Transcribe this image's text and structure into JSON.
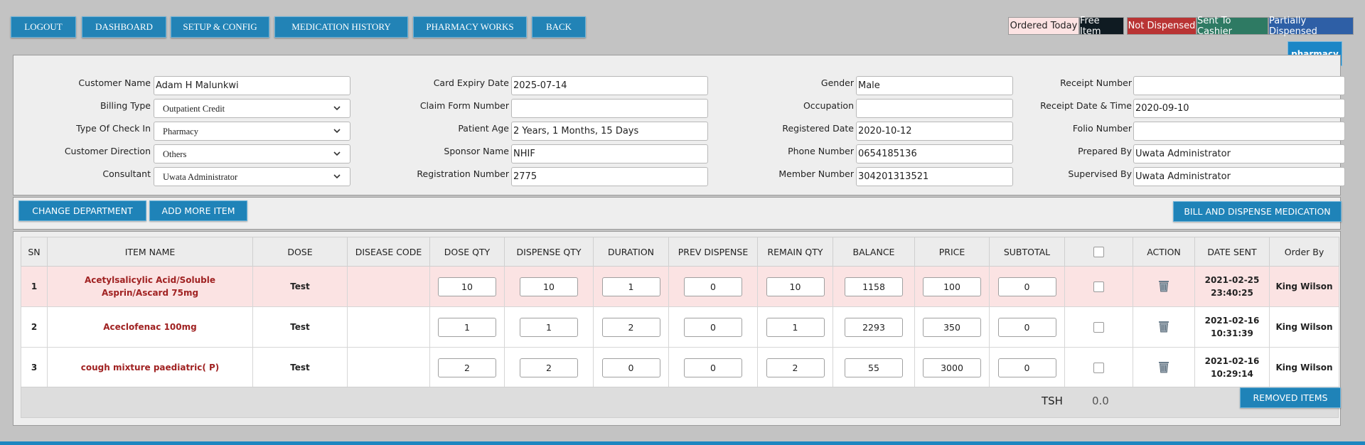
{
  "nav": {
    "logout": "LOGOUT",
    "dashboard": "DASHBOARD",
    "setup": "SETUP & CONFIG",
    "medication_history": "MEDICATION HISTORY",
    "pharmacy_works": "PHARMACY WORKS",
    "back": "BACK"
  },
  "legend": {
    "ordered_today": "Ordered Today",
    "free_item": "Free Item",
    "not_dispensed": "Not Dispensed",
    "sent_to_cashier": "Sent To Cashier",
    "partially_dispensed": "Partially Dispensed",
    "colors": {
      "ordered_today": "#fde3e3",
      "free_item": "#0f1b22",
      "not_dispensed": "#b93434",
      "sent_to_cashier": "#2e7a63",
      "partially_dispensed": "#2e5fa6"
    }
  },
  "department_tab": "pharmacy",
  "form": {
    "customer_name": {
      "label": "Customer Name",
      "value": "Adam H Malunkwi"
    },
    "billing_type": {
      "label": "Billing Type",
      "value": "Outpatient Credit"
    },
    "type_of_check_in": {
      "label": "Type Of Check In",
      "value": "Pharmacy"
    },
    "customer_direction": {
      "label": "Customer Direction",
      "value": "Others"
    },
    "consultant": {
      "label": "Consultant",
      "value": "Uwata Administrator"
    },
    "card_expiry_date": {
      "label": "Card Expiry Date",
      "value": "2025-07-14"
    },
    "claim_form_number": {
      "label": "Claim Form Number",
      "value": ""
    },
    "patient_age": {
      "label": "Patient Age",
      "value": "2 Years, 1 Months, 15 Days"
    },
    "sponsor_name": {
      "label": "Sponsor Name",
      "value": "NHIF"
    },
    "registration_number": {
      "label": "Registration Number",
      "value": "2775"
    },
    "gender": {
      "label": "Gender",
      "value": "Male"
    },
    "occupation": {
      "label": "Occupation",
      "value": ""
    },
    "registered_date": {
      "label": "Registered Date",
      "value": "2020-10-12"
    },
    "phone_number": {
      "label": "Phone Number",
      "value": "0654185136"
    },
    "member_number": {
      "label": "Member Number",
      "value": "304201313521"
    },
    "receipt_number": {
      "label": "Receipt Number",
      "value": ""
    },
    "receipt_date_time": {
      "label": "Receipt Date & Time",
      "value": "2020-09-10"
    },
    "folio_number": {
      "label": "Folio Number",
      "value": ""
    },
    "prepared_by": {
      "label": "Prepared By",
      "value": "Uwata Administrator"
    },
    "supervised_by": {
      "label": "Supervised By",
      "value": "Uwata Administrator"
    }
  },
  "actions": {
    "change_department": "CHANGE DEPARTMENT",
    "add_more_item": "ADD MORE ITEM",
    "bill_and_dispense": "BILL AND DISPENSE MEDICATION",
    "removed_items": "REMOVED ITEMS"
  },
  "table": {
    "headers": {
      "sn": "SN",
      "item_name": "ITEM NAME",
      "dose": "DOSE",
      "disease_code": "DISEASE CODE",
      "dose_qty": "DOSE QTY",
      "dispense_qty": "DISPENSE QTY",
      "duration": "DURATION",
      "prev_dispense": "PREV DISPENSE",
      "remain_qty": "REMAIN QTY",
      "balance": "BALANCE",
      "price": "PRICE",
      "subtotal": "SUBTOTAL",
      "action": "ACTION",
      "date_sent": "DATE SENT",
      "order_by": "Order By"
    },
    "rows": [
      {
        "sn": "1",
        "item_name": "Acetylsalicylic Acid/Soluble Asprin/Ascard 75mg",
        "dose": "Test",
        "disease_code": "",
        "dose_qty": "10",
        "dispense_qty": "10",
        "duration": "1",
        "prev_dispense": "0",
        "remain_qty": "10",
        "balance": "1158",
        "price": "100",
        "subtotal": "0",
        "date": "2021-02-25",
        "time": "23:40:25",
        "order_by": "King Wilson"
      },
      {
        "sn": "2",
        "item_name": "Aceclofenac 100mg",
        "dose": "Test",
        "disease_code": "",
        "dose_qty": "1",
        "dispense_qty": "1",
        "duration": "2",
        "prev_dispense": "0",
        "remain_qty": "1",
        "balance": "2293",
        "price": "350",
        "subtotal": "0",
        "date": "2021-02-16",
        "time": "10:31:39",
        "order_by": "King Wilson"
      },
      {
        "sn": "3",
        "item_name": "cough mixture paediatric( P)",
        "dose": "Test",
        "disease_code": "",
        "dose_qty": "2",
        "dispense_qty": "2",
        "duration": "0",
        "prev_dispense": "0",
        "remain_qty": "2",
        "balance": "55",
        "price": "3000",
        "subtotal": "0",
        "date": "2021-02-16",
        "time": "10:29:14",
        "order_by": "King Wilson"
      }
    ],
    "currency": "TSH",
    "total": "0.0"
  }
}
